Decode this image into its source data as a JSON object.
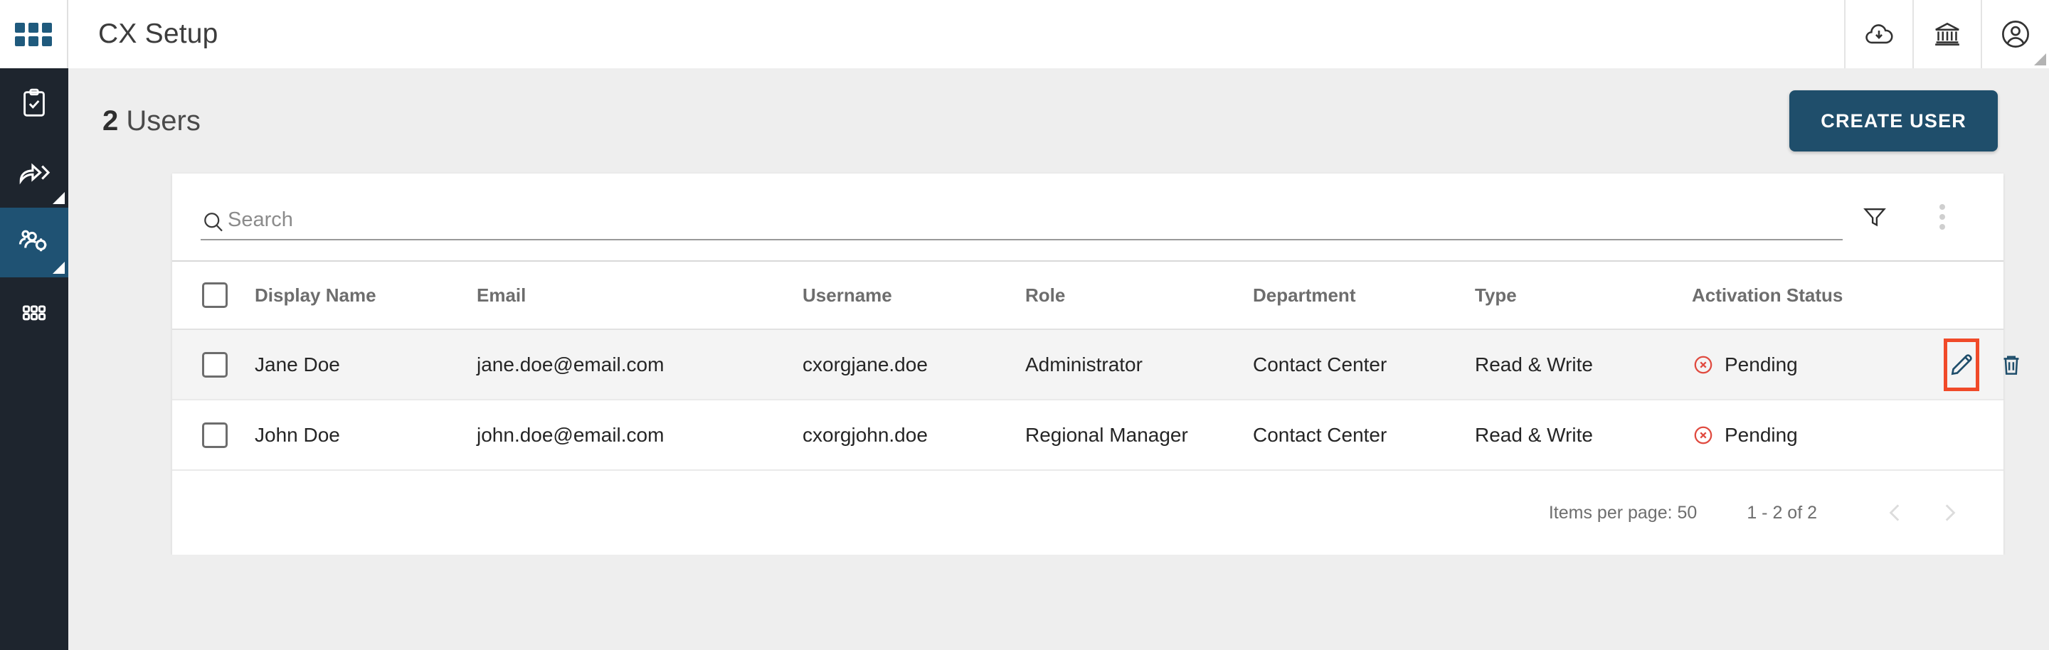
{
  "colors": {
    "sidebar_bg": "#1e252e",
    "sidebar_active": "#1f5273",
    "accent_blue": "#1f4e6b",
    "brand_icon_blue": "#1f5a7d",
    "status_pending_red": "#e04a3f",
    "highlight_outline": "#f04a29",
    "page_bg": "#eeeeee",
    "card_bg": "#ffffff"
  },
  "topbar": {
    "apps_icon": "apps-grid-icon",
    "title": "CX Setup",
    "icons": [
      {
        "name": "cloud-download-icon"
      },
      {
        "name": "bank-icon"
      },
      {
        "name": "account-circle-icon"
      }
    ]
  },
  "sidebar": {
    "items": [
      {
        "name": "sidebar-item-tasks",
        "icon": "clipboard-check-icon",
        "active": false,
        "has_submenu": false
      },
      {
        "name": "sidebar-item-routing",
        "icon": "share-arrow-icon",
        "active": false,
        "has_submenu": true
      },
      {
        "name": "sidebar-item-users",
        "icon": "users-gear-icon",
        "active": true,
        "has_submenu": true
      },
      {
        "name": "sidebar-item-apps",
        "icon": "grid-dots-icon",
        "active": false,
        "has_submenu": false
      }
    ]
  },
  "page": {
    "count": "2",
    "title_suffix": "Users",
    "create_button": "CREATE USER"
  },
  "search": {
    "placeholder": "Search",
    "value": "",
    "icon": "search-icon",
    "filter_icon": "filter-funnel-icon",
    "menu_icon": "more-vertical-icon"
  },
  "table": {
    "columns": [
      {
        "key": "checkbox",
        "label": ""
      },
      {
        "key": "name",
        "label": "Display Name"
      },
      {
        "key": "email",
        "label": "Email"
      },
      {
        "key": "username",
        "label": "Username"
      },
      {
        "key": "role",
        "label": "Role"
      },
      {
        "key": "department",
        "label": "Department"
      },
      {
        "key": "type",
        "label": "Type"
      },
      {
        "key": "status",
        "label": "Activation Status"
      },
      {
        "key": "actions",
        "label": ""
      }
    ],
    "rows": [
      {
        "name": "Jane Doe",
        "email": "jane.doe@email.com",
        "username": "cxorgjane.doe",
        "role": "Administrator",
        "department": "Contact Center",
        "type": "Read & Write",
        "status": "Pending",
        "status_icon": "error-circle-x-icon",
        "selected": false,
        "hovered": true,
        "actions": [
          "edit-icon",
          "delete-icon"
        ]
      },
      {
        "name": "John Doe",
        "email": "john.doe@email.com",
        "username": "cxorgjohn.doe",
        "role": "Regional Manager",
        "department": "Contact Center",
        "type": "Read & Write",
        "status": "Pending",
        "status_icon": "error-circle-x-icon",
        "selected": false,
        "hovered": false,
        "actions": []
      }
    ]
  },
  "paginator": {
    "items_per_page_label": "Items per page:",
    "items_per_page_value": "50",
    "range": "1 - 2 of 2",
    "prev_icon": "chevron-left-icon",
    "next_icon": "chevron-right-icon",
    "prev_disabled": true,
    "next_disabled": true
  }
}
